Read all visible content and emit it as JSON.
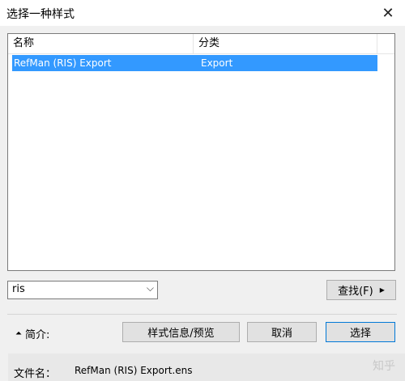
{
  "window": {
    "title": "选择一种样式",
    "close_label": "✕"
  },
  "list": {
    "columns": [
      "名称",
      "分类"
    ],
    "rows": [
      {
        "name": "RefMan (RIS) Export",
        "category": "Export",
        "selected": true
      }
    ]
  },
  "filter": {
    "value": "ris"
  },
  "buttons": {
    "find": "查找(F)",
    "info_preview": "样式信息/预览",
    "cancel": "取消",
    "select": "选择"
  },
  "intro": {
    "label": "简介:"
  },
  "file": {
    "label": "文件名：",
    "value": "RefMan (RIS) Export.ens"
  },
  "watermark": "知乎"
}
